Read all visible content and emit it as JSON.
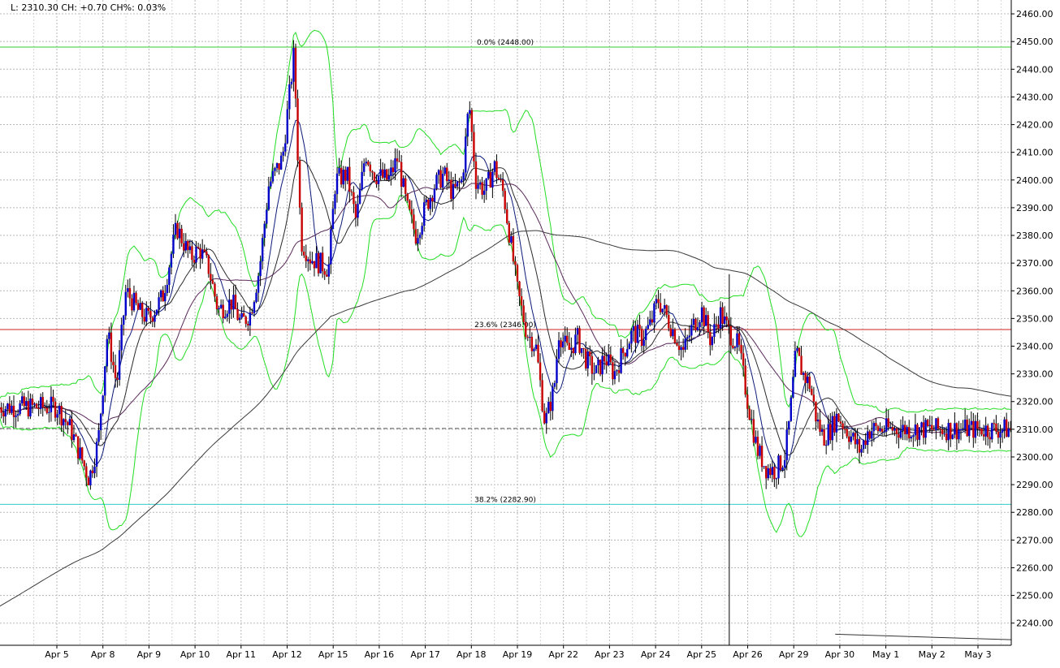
{
  "info": {
    "text": "L: 2310.30  CH: +0.70  CH%: 0.03%"
  },
  "colors": {
    "up_candle": "#0000c8",
    "down_candle": "#c80000",
    "bollinger": "#22dd22",
    "ma_fast": "#0a1a7a",
    "ma_mid": "#2a2a2a",
    "ma_slow": "#5a2a5a",
    "ma_long": "#3a3a3a",
    "fib_0": "#33cc33",
    "fib_236": "#cc2222",
    "fib_382": "#33cccc",
    "grid": "#b8b8b8"
  },
  "chart_data": {
    "type": "candlestick",
    "ylim": [
      2232,
      2465
    ],
    "grid": true,
    "yticks": [
      2240,
      2250,
      2260,
      2270,
      2280,
      2290,
      2300,
      2310,
      2320,
      2330,
      2340,
      2350,
      2360,
      2370,
      2380,
      2390,
      2400,
      2410,
      2420,
      2430,
      2440,
      2450,
      2460
    ],
    "ytick_labels": [
      "2240.00",
      "2250.00",
      "2260.00",
      "2270.00",
      "2280.00",
      "2290.00",
      "2300.00",
      "2310.00",
      "2320.00",
      "2330.00",
      "2340.00",
      "2350.00",
      "2360.00",
      "2370.00",
      "2380.00",
      "2390.00",
      "2400.00",
      "2410.00",
      "2420.00",
      "2430.00",
      "2440.00",
      "2450.00",
      "2460.00"
    ],
    "x_labels": [
      "Apr 5",
      "Apr 8",
      "Apr 9",
      "Apr 10",
      "Apr 11",
      "Apr 12",
      "Apr 15",
      "Apr 16",
      "Apr 17",
      "Apr 18",
      "Apr 19",
      "Apr 22",
      "Apr 23",
      "Apr 24",
      "Apr 25",
      "Apr 26",
      "Apr 29",
      "Apr 30",
      "May 1",
      "May 2",
      "May 3"
    ],
    "last_price": 2310.3,
    "fib_levels": [
      {
        "label": "0.0% (2448.00)",
        "value": 2448.0
      },
      {
        "label": "23.6% (2346.00)",
        "value": 2346.0
      },
      {
        "label": "38.2% (2282.90)",
        "value": 2282.9
      }
    ],
    "close_path": [
      [
        0,
        2318
      ],
      [
        0.3,
        2310
      ],
      [
        0.7,
        2292
      ],
      [
        0.9,
        2306
      ],
      [
        1.1,
        2345
      ],
      [
        1.3,
        2326
      ],
      [
        1.5,
        2360
      ],
      [
        1.8,
        2352
      ],
      [
        2.0,
        2350
      ],
      [
        2.3,
        2358
      ],
      [
        2.6,
        2383
      ],
      [
        2.9,
        2372
      ],
      [
        3.1,
        2375
      ],
      [
        3.3,
        2368
      ],
      [
        3.5,
        2353
      ],
      [
        3.8,
        2356
      ],
      [
        4.0,
        2348
      ],
      [
        4.2,
        2352
      ],
      [
        4.4,
        2368
      ],
      [
        4.6,
        2398
      ],
      [
        4.9,
        2408
      ],
      [
        5.15,
        2446
      ],
      [
        5.3,
        2378
      ],
      [
        5.5,
        2372
      ],
      [
        5.7,
        2370
      ],
      [
        5.9,
        2368
      ],
      [
        6.05,
        2400
      ],
      [
        6.3,
        2402
      ],
      [
        6.5,
        2385
      ],
      [
        6.7,
        2410
      ],
      [
        6.9,
        2402
      ],
      [
        7.2,
        2400
      ],
      [
        7.4,
        2408
      ],
      [
        7.6,
        2390
      ],
      [
        7.8,
        2380
      ],
      [
        8.0,
        2390
      ],
      [
        8.2,
        2398
      ],
      [
        8.4,
        2402
      ],
      [
        8.6,
        2395
      ],
      [
        8.8,
        2400
      ],
      [
        8.95,
        2428
      ],
      [
        9.1,
        2400
      ],
      [
        9.3,
        2396
      ],
      [
        9.5,
        2405
      ],
      [
        9.7,
        2395
      ],
      [
        9.9,
        2372
      ],
      [
        10.0,
        2360
      ],
      [
        10.2,
        2345
      ],
      [
        10.4,
        2340
      ],
      [
        10.6,
        2312
      ],
      [
        10.8,
        2325
      ],
      [
        10.9,
        2345
      ],
      [
        11.1,
        2338
      ],
      [
        11.3,
        2343
      ],
      [
        11.5,
        2335
      ],
      [
        11.7,
        2330
      ],
      [
        11.9,
        2336
      ],
      [
        12.1,
        2330
      ],
      [
        12.3,
        2338
      ],
      [
        12.5,
        2345
      ],
      [
        12.7,
        2343
      ],
      [
        12.9,
        2348
      ],
      [
        13.05,
        2357
      ],
      [
        13.2,
        2352
      ],
      [
        13.4,
        2345
      ],
      [
        13.6,
        2338
      ],
      [
        13.8,
        2347
      ],
      [
        14.0,
        2353
      ],
      [
        14.2,
        2342
      ],
      [
        14.4,
        2352
      ],
      [
        14.6,
        2345
      ],
      [
        14.8,
        2340
      ],
      [
        15.0,
        2320
      ],
      [
        15.2,
        2303
      ],
      [
        15.4,
        2296
      ],
      [
        15.6,
        2295
      ],
      [
        15.8,
        2300
      ],
      [
        15.9,
        2312
      ],
      [
        16.05,
        2338
      ],
      [
        16.2,
        2330
      ],
      [
        16.35,
        2326
      ],
      [
        16.5,
        2313
      ],
      [
        16.65,
        2307
      ],
      [
        16.8,
        2310
      ],
      [
        16.95,
        2315
      ],
      [
        17.1,
        2311
      ],
      [
        17.3,
        2306
      ],
      [
        17.45,
        2302
      ],
      [
        17.6,
        2309
      ],
      [
        17.7,
        2310
      ]
    ]
  }
}
